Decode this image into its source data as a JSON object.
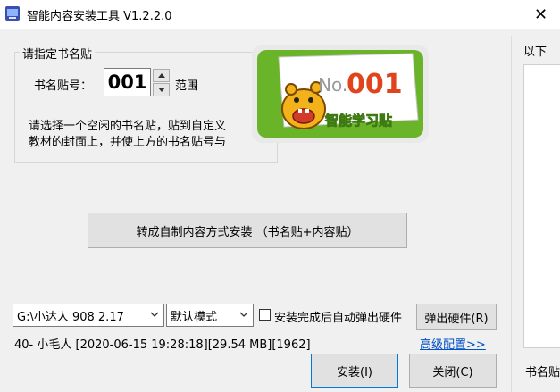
{
  "window": {
    "title": "智能内容安装工具 V1.2.2.0",
    "close_glyph": "✕"
  },
  "sticker_group": {
    "title": "请指定书名贴",
    "number_label": "书名贴号：",
    "number_value": "001",
    "range_label": "范围",
    "description_line1": "请选择一个空闲的书名贴，贴到自定义",
    "description_line2": "教材的封面上，并使上方的书名贴号与"
  },
  "sticker": {
    "no_text": "No.",
    "number": "001",
    "caption": "智能学习贴"
  },
  "convert_button": "转成自制内容方式安装 （书名贴+内容贴）",
  "drive_select": {
    "value": "G:\\小达人 908 2.17"
  },
  "mode_select": {
    "value": "默认模式"
  },
  "auto_eject": {
    "label": "安装完成后自动弹出硬件",
    "checked": false
  },
  "eject_button": "弹出硬件(R)",
  "info_text": "40- 小毛人 [2020-06-15 19:28:18][29.54 MB][1962]",
  "advanced_link": "高级配置>>",
  "install_button": "安装(I)",
  "close_button": "关闭(C)",
  "right_panel": {
    "top_label": "以下",
    "bottom_label": "书名贴"
  },
  "colors": {
    "sticker_green": "#6ab42a",
    "sticker_number": "#e0441c",
    "link": "#0050c8",
    "title_bg": "#ffffff",
    "window_bg": "#f0f0f0"
  }
}
